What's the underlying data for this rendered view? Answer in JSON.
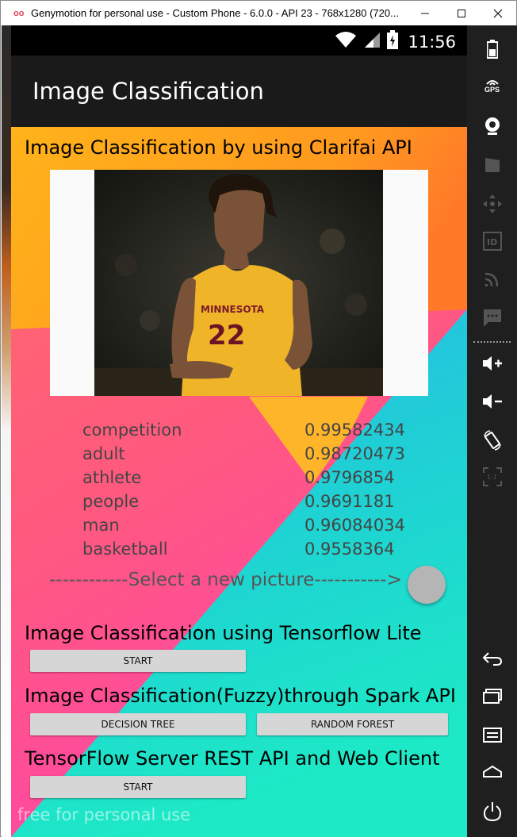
{
  "window": {
    "title": "Genymotion for personal use - Custom Phone - 6.0.0 - API 23 - 768x1280 (720...",
    "logo": "oo",
    "buttons": [
      "minimize-icon",
      "maximize-icon",
      "close-icon"
    ]
  },
  "status_bar": {
    "time": "11:56",
    "icons": [
      "wifi-icon",
      "signal-icon",
      "battery-icon"
    ]
  },
  "app_bar": {
    "title": "Image Classification"
  },
  "clarifai": {
    "heading": "Image Classification by using Clarifai API",
    "results": [
      {
        "label": "competition",
        "score": "0.99582434"
      },
      {
        "label": "adult",
        "score": "0.98720473"
      },
      {
        "label": "athlete",
        "score": "0.9796854"
      },
      {
        "label": "people",
        "score": "0.9691181"
      },
      {
        "label": "man",
        "score": "0.96084034"
      },
      {
        "label": "basketball",
        "score": "0.9558364"
      }
    ],
    "select_text": "------------Select a new picture----------->",
    "photo": {
      "jersey_text": "MINNESOTA",
      "number": "22"
    }
  },
  "tflite": {
    "heading": "Image Classification using Tensorflow Lite",
    "start_label": "START"
  },
  "spark": {
    "heading": "Image Classification(Fuzzy)through Spark API",
    "decision_tree_label": "DECISION TREE",
    "random_forest_label": "RANDOM FOREST"
  },
  "tfserver": {
    "heading": "TensorFlow Server REST API and Web Client",
    "start_label": "START"
  },
  "watermark": "free for personal use",
  "sidebar": {
    "icons": [
      "battery-icon",
      "gps-icon",
      "webcam-icon",
      "video-capture-icon",
      "dpad-icon",
      "id-icon",
      "cast-icon",
      "sms-icon",
      "volume-up-icon",
      "volume-down-icon",
      "rotate-icon",
      "scale-icon",
      "back-icon",
      "recent-apps-icon",
      "menu-icon",
      "home-icon",
      "power-icon"
    ],
    "gps_label": "GPS",
    "id_label": "ID",
    "scale_label": "1:1"
  }
}
